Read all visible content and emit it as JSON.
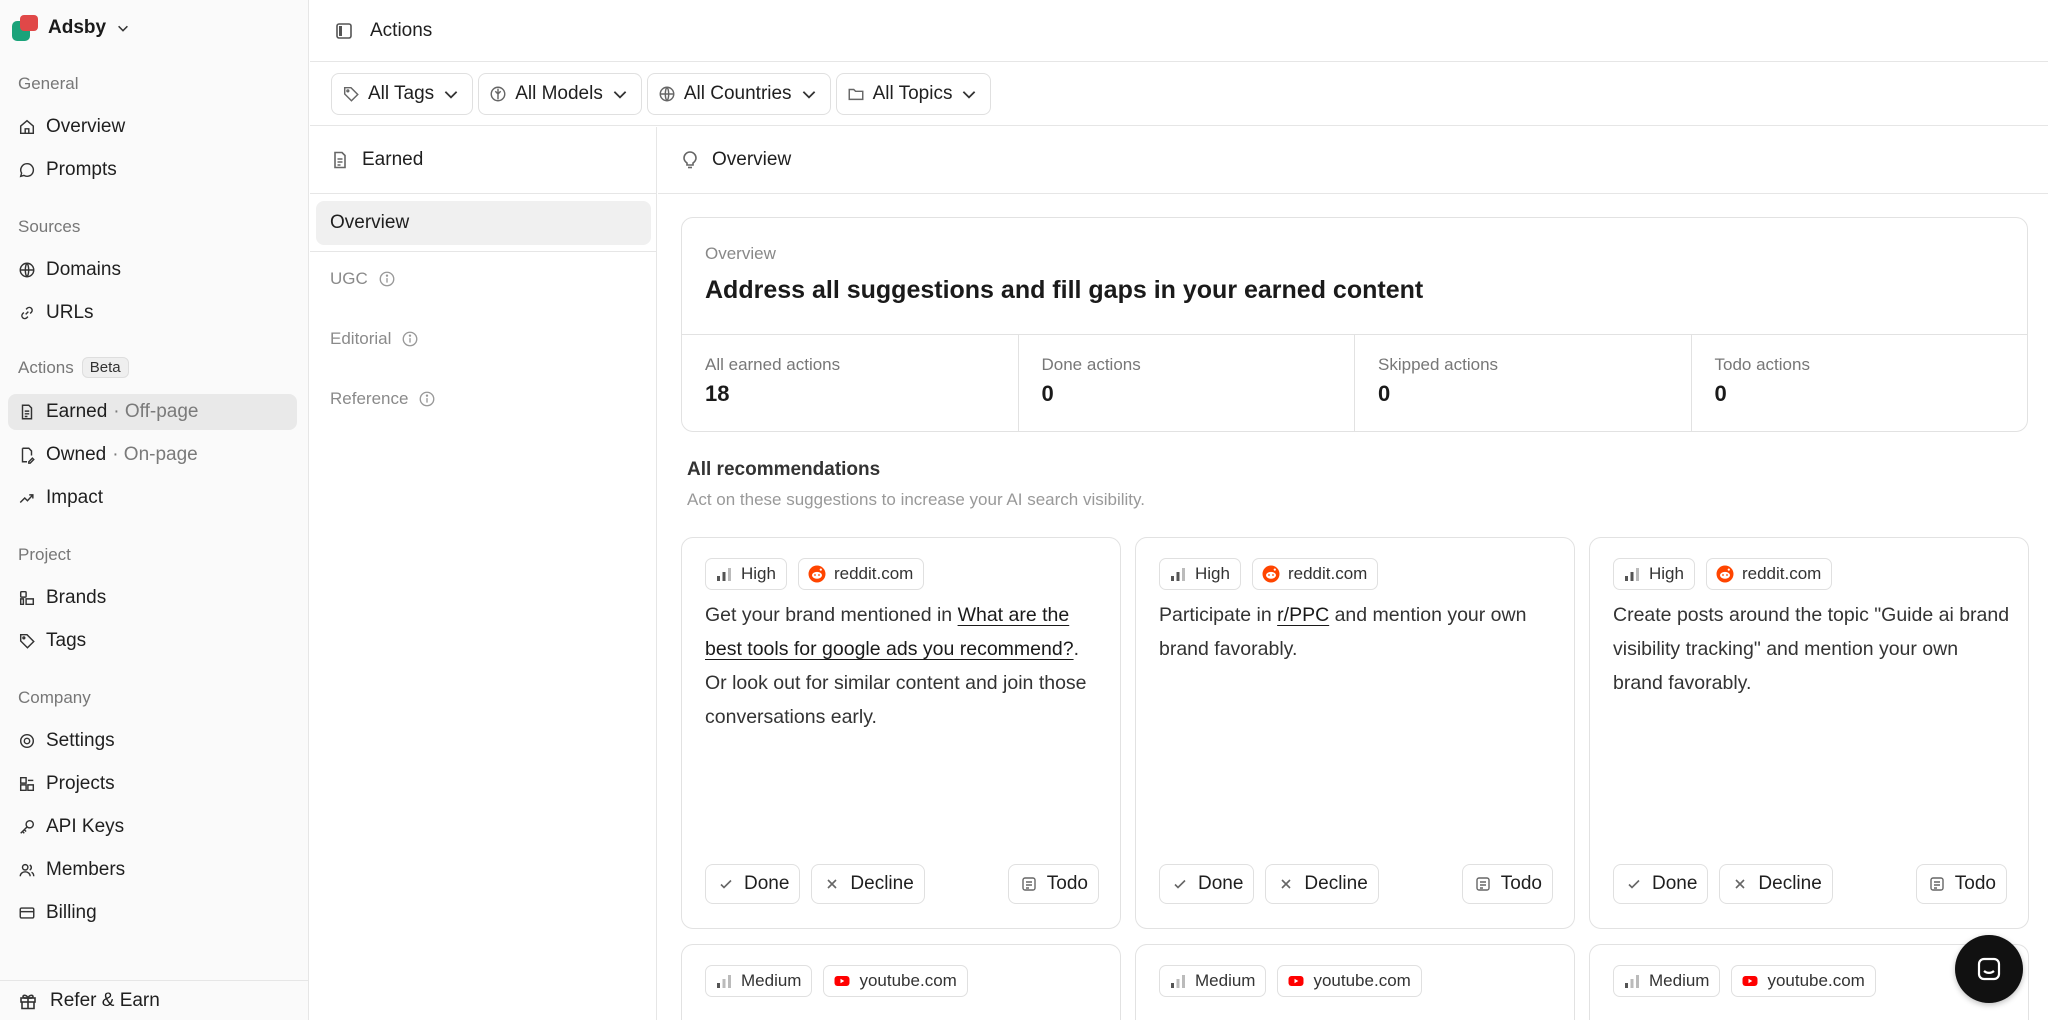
{
  "org": {
    "name": "Adsby",
    "logo_colors": [
      "#1aa37a",
      "#e04848"
    ]
  },
  "sidebar": {
    "sections": [
      {
        "label": "General",
        "items": [
          {
            "label": "Overview",
            "icon": "home-icon"
          },
          {
            "label": "Prompts",
            "icon": "chat-bubble-icon"
          }
        ]
      },
      {
        "label": "Sources",
        "items": [
          {
            "label": "Domains",
            "icon": "globe-icon"
          },
          {
            "label": "URLs",
            "icon": "link-icon"
          }
        ]
      },
      {
        "label": "Actions",
        "badge": "Beta",
        "items": [
          {
            "label": "Earned",
            "suffix": "· Off-page",
            "icon": "document-icon",
            "active": true
          },
          {
            "label": "Owned",
            "suffix": "· On-page",
            "icon": "document-edit-icon"
          },
          {
            "label": "Impact",
            "icon": "trend-up-icon"
          }
        ]
      },
      {
        "label": "Project",
        "items": [
          {
            "label": "Brands",
            "icon": "brands-icon"
          },
          {
            "label": "Tags",
            "icon": "tag-icon"
          }
        ]
      },
      {
        "label": "Company",
        "items": [
          {
            "label": "Settings",
            "icon": "gear-icon"
          },
          {
            "label": "Projects",
            "icon": "projects-icon"
          },
          {
            "label": "API Keys",
            "icon": "key-icon"
          },
          {
            "label": "Members",
            "icon": "users-icon"
          },
          {
            "label": "Billing",
            "icon": "credit-card-icon"
          }
        ]
      }
    ],
    "refer": "Refer & Earn"
  },
  "topbar": {
    "title": "Actions"
  },
  "filters": [
    {
      "label": "All Tags",
      "icon": "tag-icon"
    },
    {
      "label": "All Models",
      "icon": "model-icon"
    },
    {
      "label": "All Countries",
      "icon": "globe-icon"
    },
    {
      "label": "All Topics",
      "icon": "folder-icon"
    }
  ],
  "subnav": {
    "header": "Earned",
    "active": "Overview",
    "items": [
      "UGC",
      "Editorial",
      "Reference"
    ]
  },
  "main": {
    "header": "Overview",
    "overview": {
      "label": "Overview",
      "title": "Address all suggestions and fill gaps in your earned content",
      "stats": [
        {
          "label": "All earned actions",
          "value": "18"
        },
        {
          "label": "Done actions",
          "value": "0"
        },
        {
          "label": "Skipped actions",
          "value": "0"
        },
        {
          "label": "Todo actions",
          "value": "0"
        }
      ]
    },
    "recommendations": {
      "title": "All recommendations",
      "subtitle": "Act on these suggestions to increase your AI search visibility.",
      "buttons": {
        "done": "Done",
        "decline": "Decline",
        "todo": "Todo"
      },
      "cards": [
        {
          "priority": "High",
          "source": "reddit.com",
          "pre": "Get your brand mentioned in ",
          "link": "What are the best tools for google ads you recommend?",
          "post": ". Or look out for similar content and join those conversations early."
        },
        {
          "priority": "High",
          "source": "reddit.com",
          "pre": "Participate in ",
          "link": "r/PPC",
          "post": " and mention your own brand favorably."
        },
        {
          "priority": "High",
          "source": "reddit.com",
          "pre": "Create posts around the topic \"Guide ai brand visibility tracking\" and mention your own brand favorably.",
          "link": "",
          "post": ""
        },
        {
          "priority": "Medium",
          "source": "youtube.com"
        },
        {
          "priority": "Medium",
          "source": "youtube.com"
        },
        {
          "priority": "Medium",
          "source": "youtube.com"
        }
      ]
    }
  },
  "colors": {
    "reddit": "#ff4500",
    "youtube": "#ff0000",
    "active_bg": "#e9e9e9"
  }
}
